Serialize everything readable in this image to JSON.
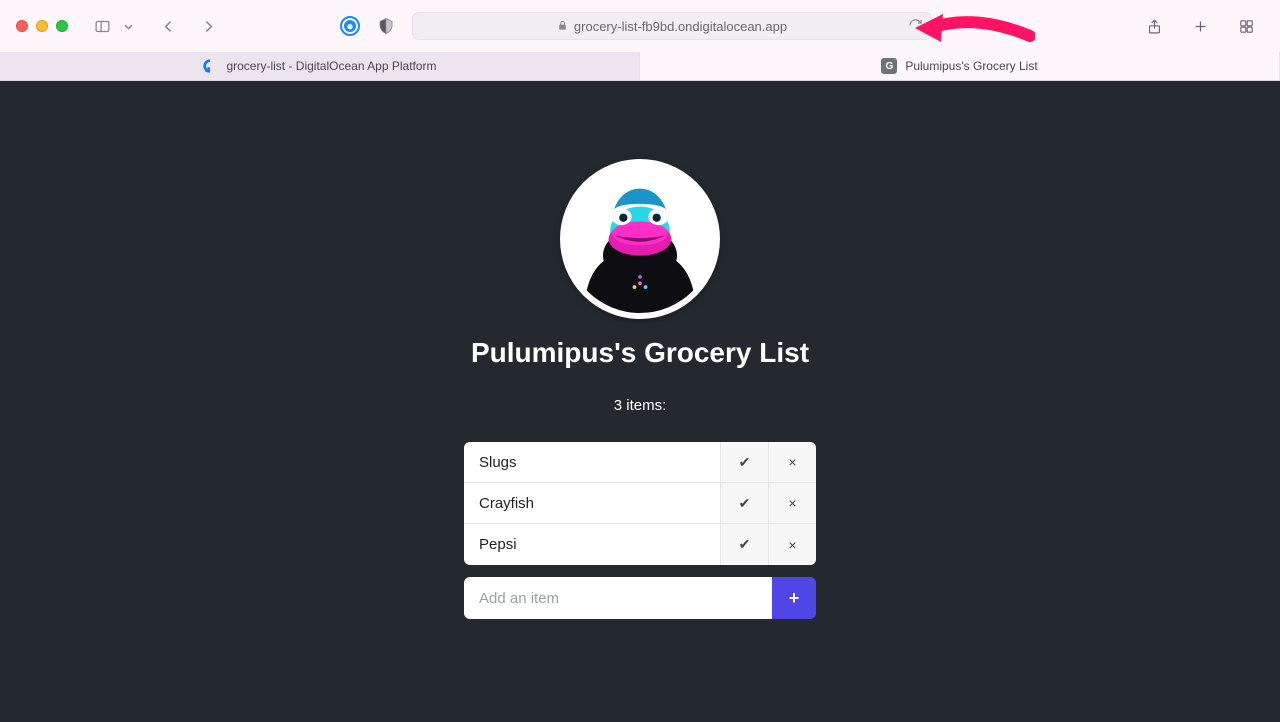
{
  "browser": {
    "url": "grocery-list-fb9bd.ondigitalocean.app",
    "tabs": [
      {
        "title": "grocery-list - DigitalOcean App Platform",
        "favicon": "do",
        "active": true
      },
      {
        "title": "Pulumipus's Grocery List",
        "favicon": "g",
        "active": false
      }
    ]
  },
  "app": {
    "title": "Pulumipus's Grocery List",
    "count_label": "3 items:",
    "items": [
      {
        "name": "Slugs"
      },
      {
        "name": "Crayfish"
      },
      {
        "name": "Pepsi"
      }
    ],
    "add_placeholder": "Add an item",
    "add_button_label": "+",
    "check_glyph": "✔",
    "delete_glyph": "×"
  },
  "colors": {
    "page_bg": "#242930",
    "accent": "#4f46e5"
  }
}
